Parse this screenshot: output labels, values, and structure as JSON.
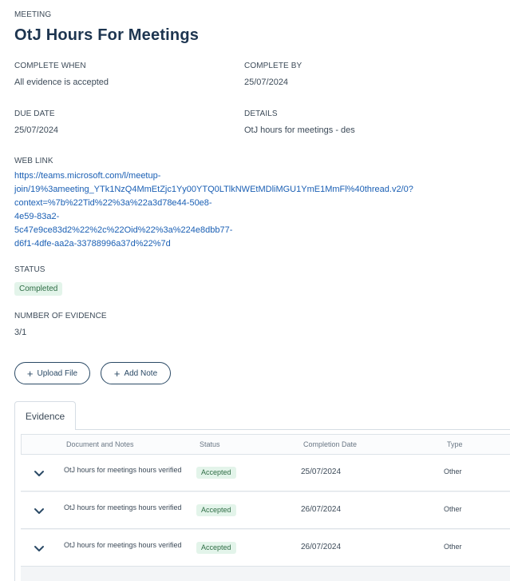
{
  "header": {
    "eyebrow": "MEETING",
    "title": "OtJ Hours For Meetings"
  },
  "fields": {
    "complete_when_label": "COMPLETE WHEN",
    "complete_when_value": "All evidence is accepted",
    "complete_by_label": "COMPLETE BY",
    "complete_by_value": "25/07/2024",
    "due_date_label": "DUE DATE",
    "due_date_value": "25/07/2024",
    "details_label": "DETAILS",
    "details_value": "OtJ hours for meetings - des",
    "web_link_label": "WEB LINK",
    "web_link_lines": [
      "https://teams.microsoft.com/l/meetup-",
      "join/19%3ameeting_YTk1NzQ4MmEtZjc1Yy00YTQ0LTlkNWEtMDliMGU1YmE1MmFl%40thread.v2/0?",
      "context=%7b%22Tid%22%3a%22a3d78e44-50e8-",
      "4e59-83a2-",
      "5c47e9ce83d2%22%2c%22Oid%22%3a%224e8dbb77-",
      "d6f1-4dfe-aa2a-33788996a37d%22%7d"
    ],
    "status_label": "STATUS",
    "status_value": "Completed",
    "evidence_count_label": "NUMBER OF EVIDENCE",
    "evidence_count_value": "3/1"
  },
  "actions": {
    "upload_label": "Upload File",
    "add_note_label": "Add Note"
  },
  "tabs": {
    "evidence_label": "Evidence"
  },
  "table": {
    "columns": [
      "Document and Notes",
      "Status",
      "Completion Date",
      "Type"
    ],
    "rows": [
      {
        "doc": "OtJ hours for meetings hours verified",
        "status": "Accepted",
        "date": "25/07/2024",
        "type": "Other"
      },
      {
        "doc": "OtJ hours for meetings hours verified",
        "status": "Accepted",
        "date": "26/07/2024",
        "type": "Other"
      },
      {
        "doc": "OtJ hours for meetings hours verified",
        "status": "Accepted",
        "date": "26/07/2024",
        "type": "Other"
      }
    ]
  },
  "colors": {
    "title": "#1d3550",
    "link": "#1a5fb4",
    "accepted_bg": "#e3f4ea",
    "accepted_text": "#2f6d45"
  }
}
